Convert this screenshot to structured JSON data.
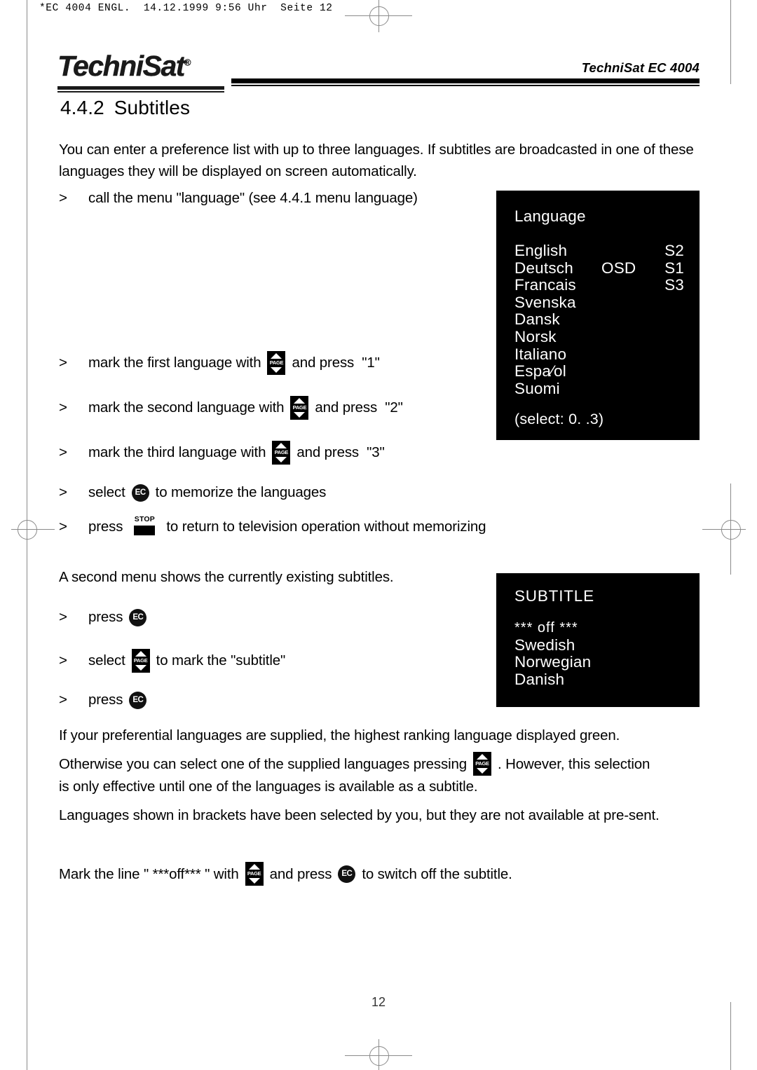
{
  "file_strip": "*EC 4004 ENGL.  14.12.1999 9:56 Uhr  Seite 12",
  "masthead": {
    "logo_text": "TechniSat",
    "logo_reg_symbol": "®",
    "model_label": "TechniSat EC 4004"
  },
  "section": {
    "number": "4.4.2",
    "title": "Subtitles"
  },
  "intro_paragraph": "You can enter a preference list with up to three languages. If subtitles are broadcasted in one of these languages they will be displayed on screen automatically.",
  "steps": {
    "chevron": ">",
    "call_menu": "call the menu \"language\" (see 4.4.1 menu language)",
    "mark_first_pre": "mark the first language with",
    "mark_first_post": "and press  \"1\"",
    "mark_second_pre": "mark the second language with",
    "mark_second_post": "and press  \"2\"",
    "mark_third_pre": "mark the third language with",
    "mark_third_post": "and press  \"3\"",
    "select_memorize_pre": "select",
    "select_memorize_post": "to memorize the languages",
    "press_stop_pre": "press",
    "press_stop_post": "to return to television operation without memorizing",
    "press_ec_1": "press",
    "select_subtitle_pre": "select",
    "select_subtitle_post": "to mark the \"subtitle\"",
    "press_ec_2": "press"
  },
  "keys": {
    "page_label": "PAGE",
    "ec_label": "EC",
    "stop_label": "STOP",
    "page_icon_name": "page-up-down-key-icon",
    "ec_icon_name": "ec-key-icon",
    "stop_icon_name": "stop-key-icon"
  },
  "osd_language": {
    "title": "Language",
    "rows": [
      {
        "name": "English",
        "osd": "",
        "slot": "S2"
      },
      {
        "name": "Deutsch",
        "osd": "OSD",
        "slot": "S1"
      },
      {
        "name": "Francais",
        "osd": "",
        "slot": "S3"
      },
      {
        "name": "Svenska",
        "osd": "",
        "slot": ""
      },
      {
        "name": "Dansk",
        "osd": "",
        "slot": ""
      },
      {
        "name": "Norsk",
        "osd": "",
        "slot": ""
      },
      {
        "name": "Italiano",
        "osd": "",
        "slot": ""
      },
      {
        "name": "Espa⁄ol",
        "osd": "",
        "slot": ""
      },
      {
        "name": "Suomi",
        "osd": "",
        "slot": ""
      }
    ],
    "footer": "(select:  0. .3)"
  },
  "osd_subtitle": {
    "title": "SUBTITLE",
    "items": [
      "*** off ***",
      "Swedish",
      "Norwegian",
      "Danish"
    ]
  },
  "second_menu_note": "A second menu shows the currently existing subtitles.",
  "paragraphs": {
    "green_note": "If your preferential languages are supplied, the highest ranking language displayed green.",
    "otherwise_pre": "Otherwise you can select one of the supplied languages pressing",
    "otherwise_post": ". However, this selection",
    "otherwise_line2": "is only effective until one of the languages is available as a subtitle.",
    "brackets_note": "Languages shown in brackets have been selected by you, but they are not available at pre-sent.",
    "mark_off_pre": "Mark the line \" ***off*** \" with",
    "mark_off_mid": "and press",
    "mark_off_post": "to switch off the subtitle."
  },
  "folio": "12",
  "colors": {
    "ink": "#000000",
    "paper": "#ffffff",
    "osd_background": "#000000",
    "osd_text": "#ffffff",
    "registration_mark": "#8a8a8a"
  }
}
